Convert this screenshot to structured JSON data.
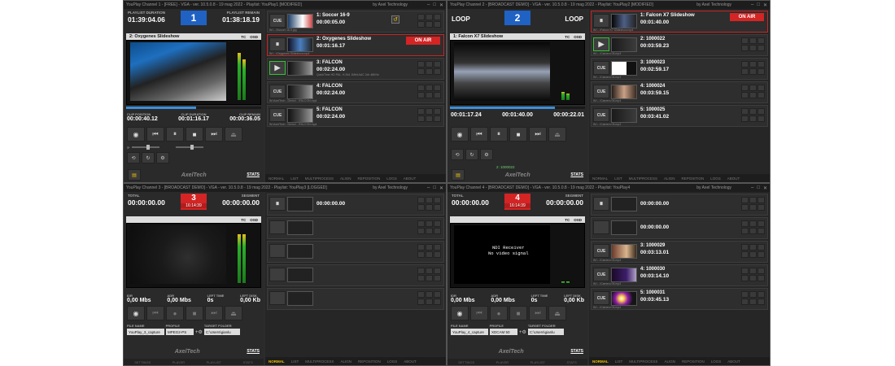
{
  "windows": [
    {
      "title": "YouPlay Channel 1 - [FREE] - VGA - ver. 10.5.0.8 - 19 mag 2022 - Playlist: YouPlay1 [MODIFIED]",
      "company": "by Axel Technology",
      "channel_number": "1",
      "left_label": "PLAYLIST DURATION",
      "left_value": "01:39:04.06",
      "right_label": "PLAYLIST REMAIN",
      "right_value": "01:38:18.19",
      "preview_name": "2: Oxygenes Slideshow",
      "clip": [
        {
          "label": "CLIP POSITION",
          "value": "00:00:40.12"
        },
        {
          "label": "CLIP DURATION",
          "value": "00:01:16.17"
        },
        {
          "label": "CLIP REMAIN",
          "value": "00:00:36.05"
        }
      ],
      "items": [
        {
          "name": "1: Soccer 16-9",
          "duration": "00:00:05.00",
          "file": "W:\\...\\Soccer 16-9.jpg",
          "meta": "QuickTime HD PAL, H.264 1Mbit AAC 2ch 48KHz",
          "state": "cue"
        },
        {
          "name": "2: Oxygenes Slideshow",
          "duration": "00:01:16.17",
          "file": "W:\\...\\Oxygenes Slideshow.mp4",
          "meta": "QuickTime HD PAL, H.264 1Mbit AAC 2ch 48KHz",
          "state": "onair"
        },
        {
          "name": "3: FALCON",
          "duration": "00:02:24.00",
          "file": "W:\\AxelTech - Demo\\...\\FALCON.mp4",
          "meta": "QuickTime HD PAL, H.264 1Mbit AAC 2ch 48KHz",
          "state": "next"
        },
        {
          "name": "4: FALCON",
          "duration": "00:02:24.00",
          "file": "W:\\AxelTech - Demo\\...\\FALCON.mp4",
          "meta": "QuickTime HD PAL, H.264 1Mbit AAC 2ch 48KHz",
          "state": "cue"
        },
        {
          "name": "5: FALCON",
          "duration": "00:02:24.00",
          "file": "W:\\AxelTech - Demo\\...\\FALCON.mp4",
          "meta": "QuickTime HD PAL, H.264 1Mbit AAC 2ch 48KHz",
          "state": "cue"
        }
      ]
    },
    {
      "title": "YouPlay Channel 2 - [BROADCAST DEMO] - VGA - ver. 10.5.0.8 - 19 mag 2022 - Playlist: YouPlay2 [MODIFIED]",
      "company": "by Axel Technology",
      "channel_number": "2",
      "loop_left": "LOOP",
      "loop_right": "LOOP",
      "preview_name": "1: Falcon X7 Slideshow",
      "clip": [
        {
          "label": "",
          "value": "00:01:17.24"
        },
        {
          "label": "",
          "value": "00:01:40.00"
        },
        {
          "label": "",
          "value": "00:00:22.01"
        }
      ],
      "next_label": "2: 1000022",
      "items": [
        {
          "name": "1: Falcon X7 Slideshow",
          "duration": "00:01:40.00",
          "file": "W:\\...\\Falcon X7 Slideshow.mp4",
          "meta": "QuickTime HD PAL, H.264 1Mbit AAC 2ch 48KHz",
          "state": "onair"
        },
        {
          "name": "2: 1000022",
          "duration": "00:03:59.23",
          "file": "W:\\...\\Camera 06.mp4",
          "meta": "QuickTime HD PAL, H.264 1Mbit AAC 2ch 48KHz",
          "state": "next"
        },
        {
          "name": "3: 1000023",
          "duration": "00:02:59.17",
          "file": "W:\\...\\Camera 06.mp4",
          "meta": "QuickTime HD PAL, H.264 1Mbit AAC 2ch 48KHz",
          "state": "cue"
        },
        {
          "name": "4: 1000024",
          "duration": "00:03:59.15",
          "file": "W:\\...\\Camera 06.mp4",
          "meta": "QuickTime HD PAL, H.264 1Mbit AAC 2ch 48KHz",
          "state": "cue"
        },
        {
          "name": "5: 1000025",
          "duration": "00:03:41.02",
          "file": "W:\\...\\Camera 06.mp4",
          "meta": "QuickTime HD PAL, H.264 1Mbit AAC 2ch 48KHz",
          "state": "cue"
        }
      ]
    },
    {
      "title": "YouPlay Channel 3 - [BROADCAST DEMO] - VGA - ver. 10.5.0.8 - 19 mag 2022 - Playlist: YouPlay3 [LOGGED]",
      "company": "by Axel Technology",
      "channel_number": "3",
      "channel_time": "16:14:39",
      "left_label": "TOTAL",
      "left_value": "00:00:00.00",
      "right_label": "SEGMENT",
      "right_value": "00:00:00.00",
      "rec": [
        {
          "label": "IDR",
          "value": "0,00 Mbs"
        },
        {
          "label": "ADR",
          "value": "0,00 Mbs"
        },
        {
          "label": "LEFT TIME",
          "value": "0s"
        },
        {
          "label": "LEFT DISK",
          "value": "0,00 Kb"
        }
      ],
      "file_name": "YouPlay_3_capture",
      "profile": "MPEG2-PS",
      "target_folder": "C:\\Users\\gianlu",
      "items": [
        {
          "name": "",
          "duration": "00:00:00.00",
          "state": "empty"
        },
        {
          "name": "",
          "duration": "",
          "state": "empty"
        },
        {
          "name": "",
          "duration": "",
          "state": "empty"
        },
        {
          "name": "",
          "duration": "",
          "state": "empty"
        },
        {
          "name": "",
          "duration": "",
          "state": "empty"
        }
      ]
    },
    {
      "title": "YouPlay Channel 4 - [BROADCAST DEMO] - VGA - ver. 10.5.0.8 - 19 mag 2022 - Playlist: YouPlay4",
      "company": "by Axel Technology",
      "channel_number": "4",
      "channel_time": "16:14:39",
      "left_label": "TOTAL",
      "left_value": "00:00:00.00",
      "right_label": "SEGMENT",
      "right_value": "00:00:00.00",
      "ndi_line1": "NDI Receiver",
      "ndi_line2": "No video signal",
      "rec": [
        {
          "label": "IDR",
          "value": "0,00 Mbs"
        },
        {
          "label": "ADR",
          "value": "0,00 Mbs"
        },
        {
          "label": "LEFT TIME",
          "value": "0s"
        },
        {
          "label": "LEFT DISK",
          "value": "0,00 Kb"
        }
      ],
      "file_name": "YouPlay_4_capture",
      "profile": "XDCAM 50",
      "target_folder": "C:\\Users\\gianlu",
      "items": [
        {
          "name": "",
          "duration": "00:00:00.00",
          "state": "empty"
        },
        {
          "name": "",
          "duration": "00:00:00.00",
          "state": "empty"
        },
        {
          "name": "3: 1000029",
          "duration": "00:03:13.01",
          "file": "W:\\...\\Camera 06.mp4",
          "meta": "QuickTime HD PAL, H.264 1Mbit AAC 2ch 48KHz",
          "state": "cue"
        },
        {
          "name": "4: 1000030",
          "duration": "00:03:14.10",
          "file": "W:\\...\\Camera 06.mp4",
          "meta": "QuickTime HD PAL, H.264 1Mbit AAC 2ch 48KHz",
          "state": "cue"
        },
        {
          "name": "5: 1000031",
          "duration": "00:03:45.13",
          "file": "W:\\...\\Camera 06.mp4",
          "meta": "QuickTime HD PAL, H.264 1Mbit AAC 2ch 48KHz",
          "state": "cue"
        }
      ]
    }
  ],
  "common": {
    "on_air_label": "ON AIR",
    "cue_label": "CUE",
    "tc_label": "TC",
    "osd_label": "OSD",
    "stats_label": "STATS",
    "logo_text": "AxelTech",
    "file_name_label": "FILE NAME",
    "profile_label": "PROFILE",
    "target_folder_label": "TARGET FOLDER",
    "tabs": [
      "NORMAL",
      "LIST",
      "MULTIPROCESS",
      "ALIGN",
      "REPOSITION",
      "LOGS",
      "ABOUT"
    ],
    "left_tabs": [
      "SETTINGS",
      "PLAYER",
      "PLAYLIST",
      "STATS"
    ]
  }
}
